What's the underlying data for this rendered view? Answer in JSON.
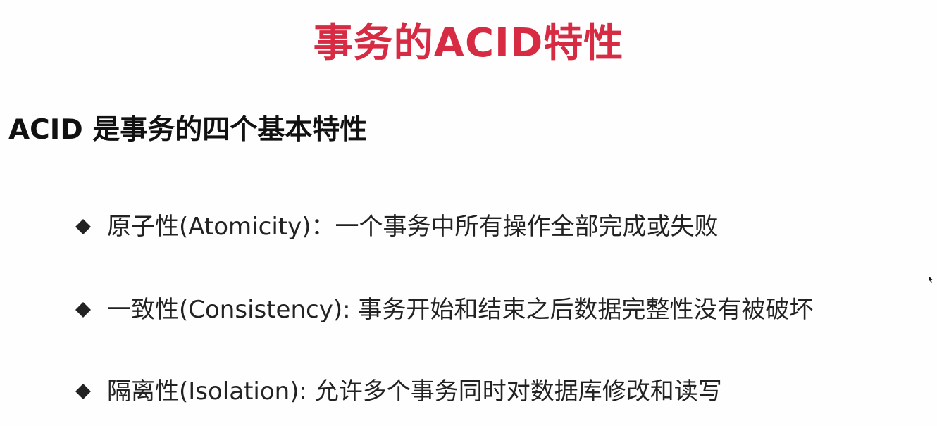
{
  "slide": {
    "title": "事务的ACID特性",
    "subtitle": "ACID 是事务的四个基本特性",
    "bullets": [
      {
        "icon": "diamond-bullet-icon",
        "text": "原子性(Atomicity)：一个事务中所有操作全部完成或失败"
      },
      {
        "icon": "diamond-bullet-icon",
        "text": "一致性(Consistency): 事务开始和结束之后数据完整性没有被破坏"
      },
      {
        "icon": "diamond-bullet-icon",
        "text": "隔离性(Isolation): 允许多个事务同时对数据库修改和读写"
      }
    ]
  },
  "colors": {
    "title": "#d72b43",
    "text": "#222222",
    "background": "#fefefe"
  }
}
